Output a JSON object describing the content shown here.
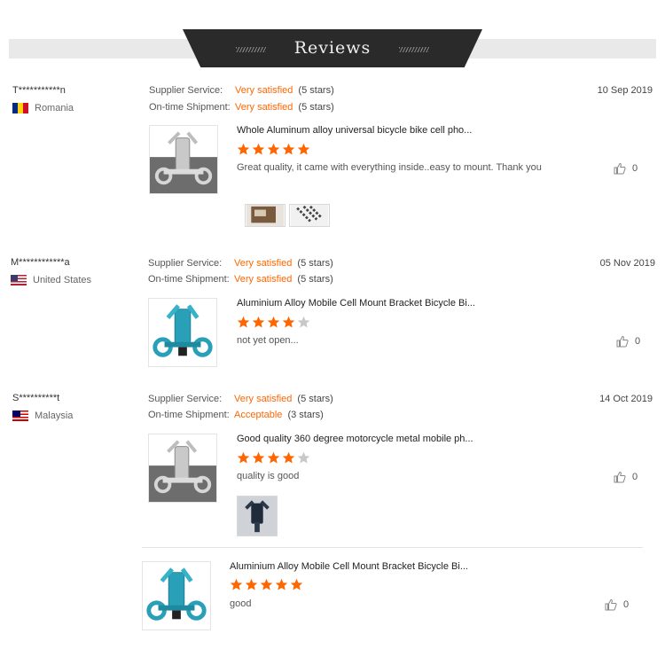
{
  "header": {
    "title": "Reviews"
  },
  "colors": {
    "accent": "#ff6600",
    "banner": "#2a2a2a",
    "star_empty": "#c8c8c8"
  },
  "labels": {
    "supplier_service": "Supplier Service:",
    "shipment": "On-time Shipment:"
  },
  "reviews": [
    {
      "user": "T***********n",
      "country": "Romania",
      "flag": "romania-flag",
      "supplier_value": "Very satisfied",
      "supplier_stars": "(5 stars)",
      "shipment_value": "Very satisfied",
      "shipment_stars": "(5 stars)",
      "date": "10 Sep 2019",
      "product_title": "Whole Aluminum alloy universal bicycle bike cell pho...",
      "rating": 5,
      "comment": "Great quality, it came with everything inside..easy to mount. Thank you",
      "likes": "0",
      "thumb": "silver-mount-image",
      "photos": [
        "box-photo",
        "mount-photo"
      ]
    },
    {
      "user": "M************a",
      "country": "United States",
      "flag": "us-flag",
      "supplier_value": "Very satisfied",
      "supplier_stars": "(5 stars)",
      "shipment_value": "Very satisfied",
      "shipment_stars": "(5 stars)",
      "date": "05 Nov 2019",
      "product_title": "Aluminium Alloy Mobile Cell Mount Bracket Bicycle Bi...",
      "rating": 4,
      "comment": "not yet open...",
      "likes": "0",
      "thumb": "blue-mount-image",
      "photos": []
    },
    {
      "user": "S**********t",
      "country": "Malaysia",
      "flag": "malaysia-flag",
      "supplier_value": "Very satisfied",
      "supplier_stars": "(5 stars)",
      "shipment_value": "Acceptable",
      "shipment_stars": "(3 stars)",
      "date": "14 Oct 2019",
      "product_title": "Good quality 360 degree motorcycle metal mobile ph...",
      "rating": 4,
      "comment": "quality is good",
      "likes": "0",
      "thumb": "silver-mount-image",
      "photos": [
        "phone-holder-photo"
      ]
    }
  ],
  "additional": {
    "product_title": "Aluminium Alloy Mobile Cell Mount Bracket Bicycle Bi...",
    "rating": 5,
    "comment": "good",
    "likes": "0",
    "thumb": "blue-mount-image"
  }
}
